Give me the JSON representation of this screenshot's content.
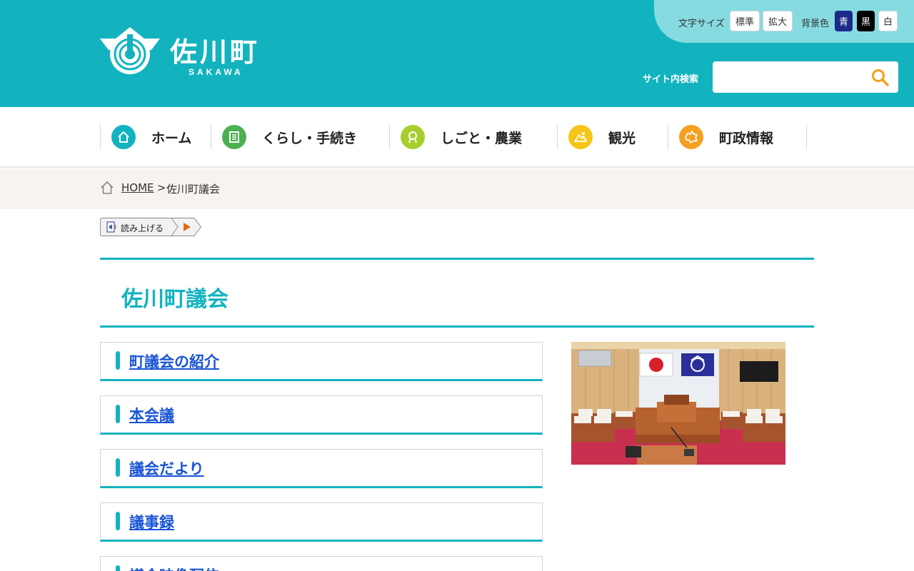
{
  "header": {
    "logo_jp": "佐川町",
    "logo_en": "SAKAWA",
    "font_size_label": "文字サイズ",
    "font_size_options": [
      "標準",
      "拡大"
    ],
    "bg_color_label": "背景色",
    "bg_color_options": [
      "青",
      "黒",
      "白"
    ],
    "search_label": "サイト内検索",
    "search_placeholder": "",
    "search_icon": "search-icon"
  },
  "nav": {
    "items": [
      {
        "label": "ホーム",
        "icon": "home-icon",
        "color": "#12b3bf"
      },
      {
        "label": "くらし・手続き",
        "icon": "document-icon",
        "color": "#4caf50"
      },
      {
        "label": "しごと・農業",
        "icon": "person-icon",
        "color": "#a6cf2e"
      },
      {
        "label": "観光",
        "icon": "mountain-icon",
        "color": "#f5c518"
      },
      {
        "label": "町政情報",
        "icon": "town-map-icon",
        "color": "#f5a01f"
      }
    ]
  },
  "breadcrumb": {
    "home": "HOME",
    "separator": ">",
    "current": "佐川町議会"
  },
  "readaloud": {
    "label": "読み上げる"
  },
  "page": {
    "title": "佐川町議会"
  },
  "links": [
    {
      "label": "町議会の紹介"
    },
    {
      "label": "本会議"
    },
    {
      "label": "議会だより"
    },
    {
      "label": "議事録"
    },
    {
      "label": "議会映像配信"
    }
  ],
  "colors": {
    "accent": "#12b3bf",
    "link": "#1a55d6",
    "util_bar": "#86dbe1"
  }
}
